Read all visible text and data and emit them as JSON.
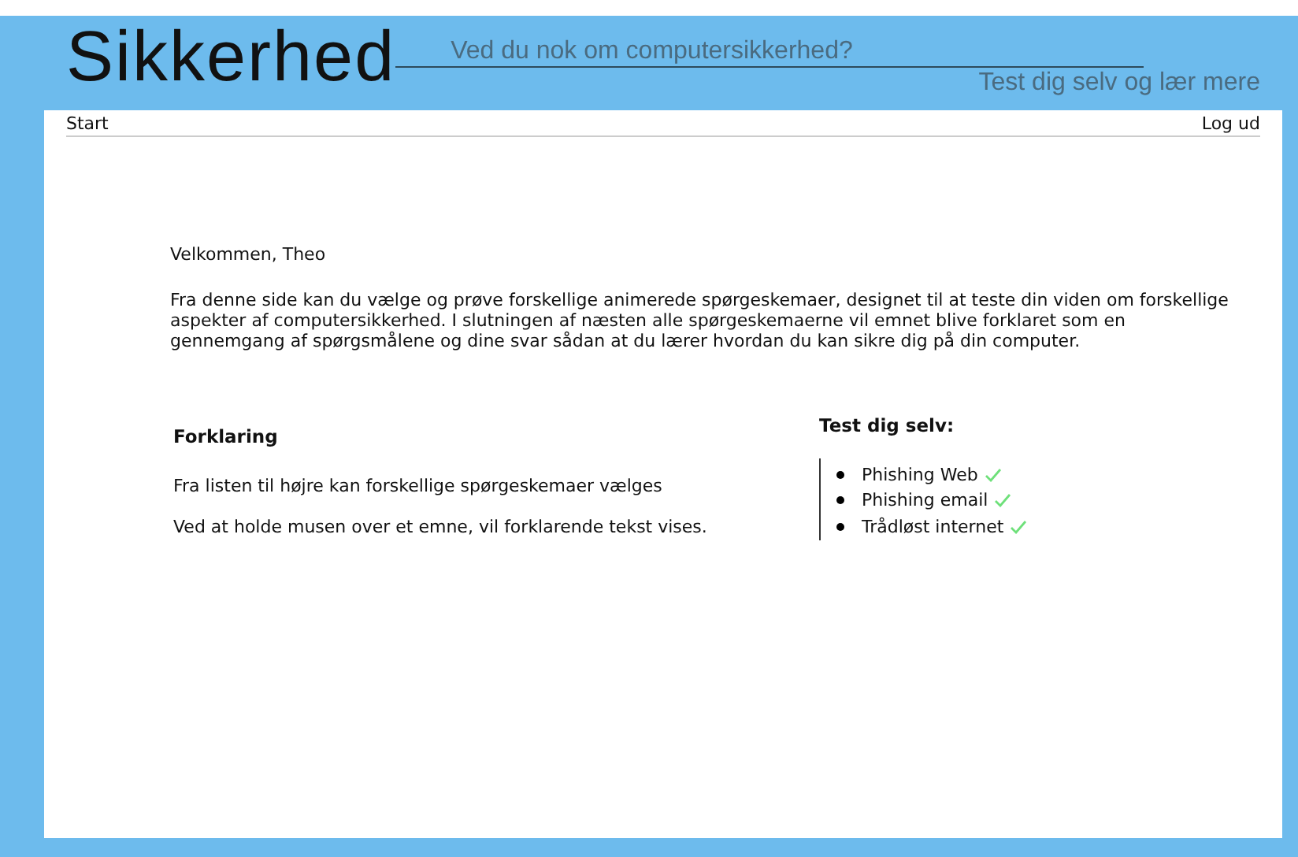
{
  "header": {
    "title": "Sikkerhed",
    "tagline": "Ved du nok om computersikkerhed?",
    "subtitle": "Test dig selv og lær mere"
  },
  "nav": {
    "left": "Start",
    "right": "Log ud"
  },
  "welcome": "Velkommen, Theo",
  "intro": "Fra denne side kan du vælge og prøve forskellige animerede spørgeskemaer, designet til at teste din viden om forskellige aspekter af computersikkerhed. I slutningen af næsten alle spørgeskemaerne vil emnet blive forklaret som en gennemgang af spørgsmålene og dine svar sådan at du lærer hvordan du kan sikre dig på din computer.",
  "explanation": {
    "heading": "Forklaring",
    "paragraphs": [
      "Fra listen til højre kan forskellige spørgeskemaer vælges",
      "Ved at holde musen over et emne, vil forklarende tekst vises."
    ]
  },
  "quizzes": {
    "heading": "Test dig selv:",
    "items": [
      {
        "label": "Phishing Web",
        "completed": true
      },
      {
        "label": "Phishing email",
        "completed": true
      },
      {
        "label": "Trådløst internet",
        "completed": true
      }
    ]
  }
}
